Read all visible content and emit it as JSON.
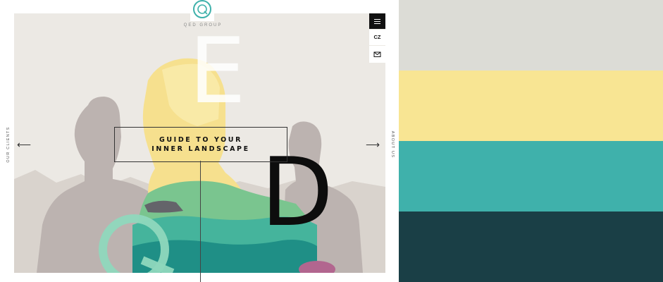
{
  "brand": {
    "name": "QED GROUP",
    "logo_letter": "Q"
  },
  "hero": {
    "headline_line1": "GUIDE TO YOUR",
    "headline_line2": "INNER LANDSCAPE",
    "letter_e": "E",
    "letter_d": "D"
  },
  "nav": {
    "menu_icon": "hamburger-icon",
    "lang_label": "CZ",
    "mail_icon": "envelope-icon"
  },
  "sides": {
    "left_label": "OUR CLIENTS",
    "left_arrow": "⟵",
    "right_label": "ABOUT US",
    "right_arrow": "⟶"
  },
  "colors": {
    "hero_bg": "#ece9e4",
    "teal_accent": "#3fb1ab",
    "mint": "#8fd8bd",
    "yellow": "#f8e593"
  },
  "palette": [
    {
      "name": "light-gray",
      "color": "#dcdcd6"
    },
    {
      "name": "yellow",
      "color": "#f8e593"
    },
    {
      "name": "teal",
      "color": "#3fb1ab"
    },
    {
      "name": "dark-teal",
      "color": "#1a3f46"
    }
  ]
}
